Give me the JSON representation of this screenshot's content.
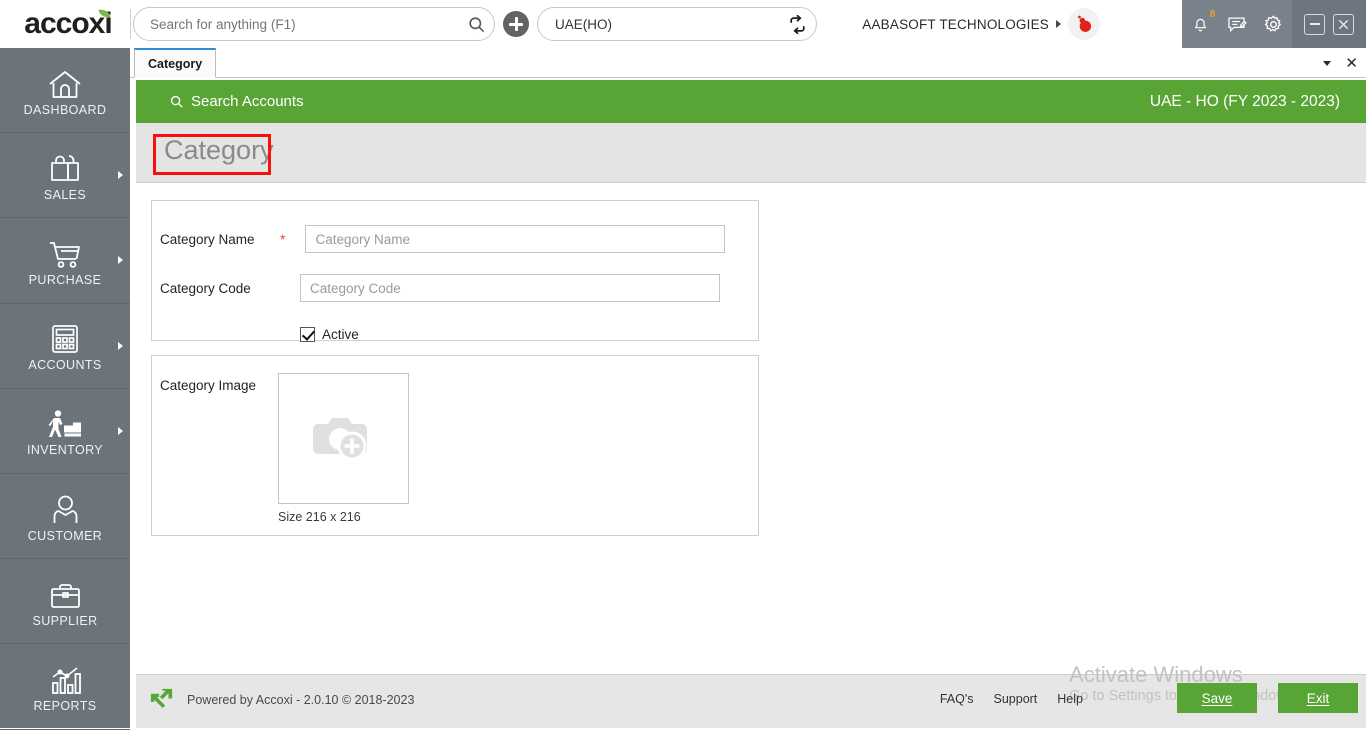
{
  "app": {
    "brand": "accoxi",
    "brand_leaf_color": "#7ab648",
    "accent_green": "#58a535",
    "sidebar_color": "#6b737b"
  },
  "topbar": {
    "search": {
      "placeholder": "Search for anything (F1)",
      "value": "",
      "icon": "search-icon"
    },
    "add_button_icon": "plus-circle-icon",
    "branch": {
      "value": "UAE(HO)",
      "refresh_icon": "switch-refresh-icon"
    },
    "company": {
      "name": "AABASOFT TECHNOLOGIES",
      "caret_icon": "caret-right-icon",
      "avatar_icon": "user-avatar-icon"
    },
    "icons": [
      {
        "name": "notification-bell-icon",
        "badge": "8",
        "badge_color": "#f0a030"
      },
      {
        "name": "message-note-icon",
        "badge": ""
      },
      {
        "name": "settings-gear-icon",
        "badge": ""
      }
    ],
    "window_controls": [
      {
        "name": "minimize-button",
        "glyph": "minimize"
      },
      {
        "name": "close-button",
        "glyph": "close"
      }
    ]
  },
  "sidebar": {
    "items": [
      {
        "label": "DASHBOARD",
        "icon": "home-icon",
        "has_submenu": false
      },
      {
        "label": "SALES",
        "icon": "shopping-bag-icon",
        "has_submenu": true
      },
      {
        "label": "PURCHASE",
        "icon": "shopping-cart-icon",
        "has_submenu": true
      },
      {
        "label": "ACCOUNTS",
        "icon": "calculator-icon",
        "has_submenu": true
      },
      {
        "label": "INVENTORY",
        "icon": "warehouse-worker-icon",
        "has_submenu": true
      },
      {
        "label": "CUSTOMER",
        "icon": "person-icon",
        "has_submenu": false
      },
      {
        "label": "SUPPLIER",
        "icon": "briefcase-icon",
        "has_submenu": false
      },
      {
        "label": "REPORTS",
        "icon": "bar-chart-icon",
        "has_submenu": false
      }
    ]
  },
  "tabs": {
    "items": [
      {
        "label": "Category",
        "active": true
      }
    ],
    "dropdown_icon": "chevron-down-icon",
    "close_icon": "close-icon",
    "close_glyph": "✕"
  },
  "green_header": {
    "search_accounts_label": "Search Accounts",
    "search_icon": "search-icon",
    "context_label": "UAE - HO (FY 2023 - 2023)"
  },
  "page": {
    "title": "Category",
    "title_highlighted": true,
    "highlight_color": "#fa0f0f"
  },
  "form": {
    "fields": [
      {
        "label": "Category Name",
        "required": true,
        "required_marker": "*",
        "placeholder": "Category Name",
        "value": ""
      },
      {
        "label": "Category Code",
        "required": false,
        "required_marker": "",
        "placeholder": "Category Code",
        "value": ""
      }
    ],
    "active_checkbox": {
      "label": "Active",
      "checked": true
    },
    "image_section": {
      "label": "Category Image",
      "placeholder_icon": "camera-add-icon",
      "size_hint": "Size 216 x 216"
    }
  },
  "watermark": {
    "line1": "Activate Windows",
    "line2": "Go to Settings to activate Windows."
  },
  "footer": {
    "logo_icon": "accoxi-arrow-icon",
    "powered_by": "Powered by Accoxi - 2.0.10 © 2018-2023",
    "links": [
      {
        "label": "FAQ's"
      },
      {
        "label": "Support"
      },
      {
        "label": "Help"
      }
    ],
    "buttons": [
      {
        "label": "Save",
        "accesskey": "S",
        "name": "save-button"
      },
      {
        "label": "Exit",
        "accesskey": "E",
        "name": "exit-button"
      }
    ]
  }
}
